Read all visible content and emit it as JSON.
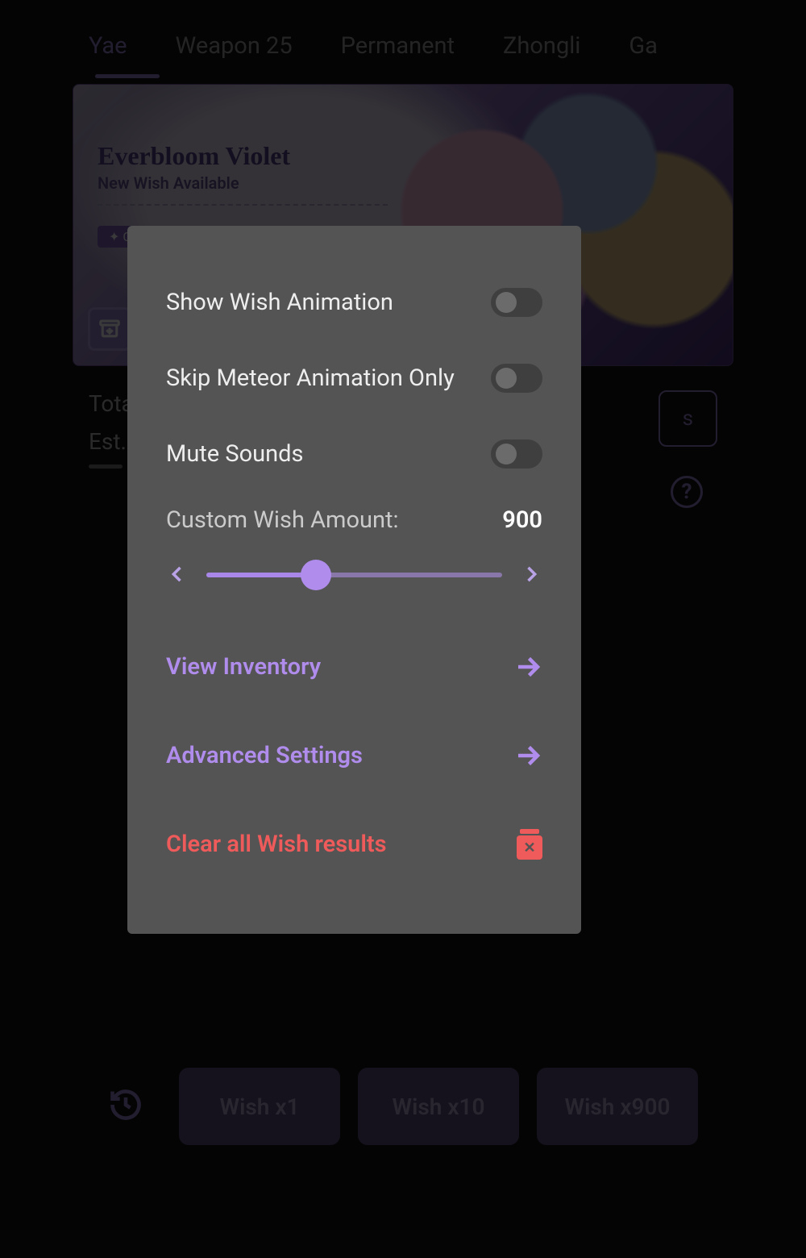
{
  "tabs": {
    "items": [
      {
        "label": "Yae",
        "active": true
      },
      {
        "label": "Weapon 25",
        "active": false
      },
      {
        "label": "Permanent",
        "active": false
      },
      {
        "label": "Zhongli",
        "active": false
      },
      {
        "label": "Ga",
        "active": false
      }
    ]
  },
  "banner": {
    "title": "Everbloom Violet",
    "subtitle": "New Wish Available",
    "tag": "✦ Character Event Wish"
  },
  "stats": {
    "total_label": "Tota",
    "est_label": "Est.",
    "details_button": "s",
    "help_glyph": "?"
  },
  "dock": {
    "wish1": "Wish x1",
    "wish10": "Wish x10",
    "wish_custom": "Wish x900"
  },
  "modal": {
    "show_animation": "Show Wish Animation",
    "skip_meteor": "Skip Meteor Animation Only",
    "mute_sounds": "Mute Sounds",
    "custom_amount_label": "Custom Wish Amount:",
    "custom_amount_value": "900",
    "slider_percent": 37,
    "view_inventory": "View Inventory",
    "advanced_settings": "Advanced Settings",
    "clear_all": "Clear all Wish results",
    "toggles": {
      "show_animation": false,
      "skip_meteor": false,
      "mute_sounds": false
    }
  },
  "colors": {
    "accent": "#b08ded",
    "danger": "#ef5a5a"
  }
}
